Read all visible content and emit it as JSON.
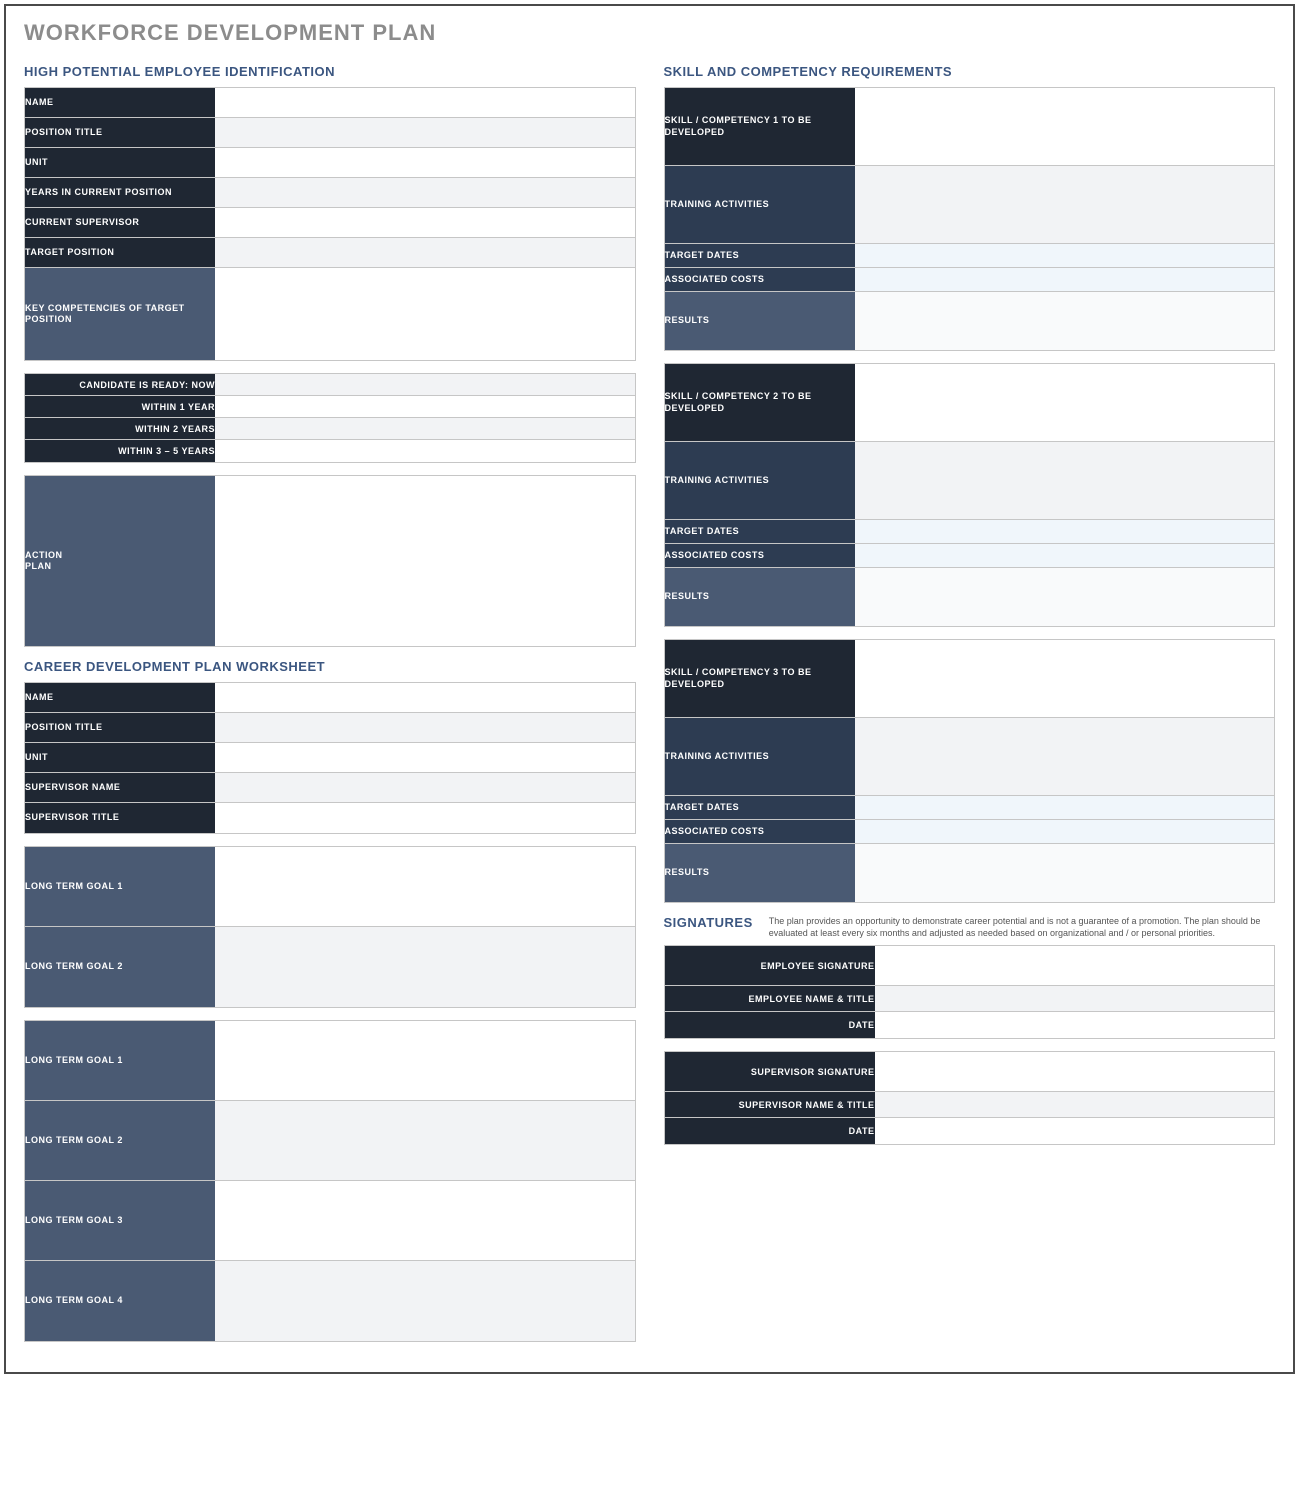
{
  "title": "WORKFORCE DEVELOPMENT PLAN",
  "left": {
    "section1_title": "HIGH POTENTIAL EMPLOYEE IDENTIFICATION",
    "name_lbl": "NAME",
    "position_lbl": "POSITION TITLE",
    "unit_lbl": "UNIT",
    "years_lbl": "YEARS IN CURRENT POSITION",
    "supervisor_lbl": "CURRENT SUPERVISOR",
    "target_pos_lbl": "TARGET POSITION",
    "key_comp_lbl": "KEY COMPETENCIES OF TARGET POSITION",
    "ready_now_lbl": "CANDIDATE IS READY:  NOW",
    "ready_1y_lbl": "WITHIN 1 YEAR",
    "ready_2y_lbl": "WITHIN 2 YEARS",
    "ready_35y_lbl": "WITHIN 3 – 5 YEARS",
    "action_plan_lbl": "ACTION\nPLAN",
    "section2_title": "CAREER DEVELOPMENT PLAN WORKSHEET",
    "c_name_lbl": "NAME",
    "c_position_lbl": "POSITION TITLE",
    "c_unit_lbl": "UNIT",
    "c_supname_lbl": "SUPERVISOR NAME",
    "c_suptitle_lbl": "SUPERVISOR TITLE",
    "ltg1a": "LONG TERM GOAL 1",
    "ltg2a": "LONG TERM GOAL 2",
    "ltg1b": "LONG TERM GOAL 1",
    "ltg2b": "LONG TERM GOAL 2",
    "ltg3b": "LONG TERM GOAL 3",
    "ltg4b": "LONG TERM GOAL 4"
  },
  "right": {
    "section_title": "SKILL AND COMPETENCY REQUIREMENTS",
    "sc1": "SKILL / COMPETENCY 1 TO BE DEVELOPED",
    "sc2": "SKILL / COMPETENCY 2 TO BE DEVELOPED",
    "sc3": "SKILL / COMPETENCY 3 TO BE DEVELOPED",
    "training_lbl": "TRAINING ACTIVITIES",
    "target_dates_lbl": "TARGET DATES",
    "costs_lbl": "ASSOCIATED COSTS",
    "results_lbl": "RESULTS",
    "sig_title": "SIGNATURES",
    "sig_desc": "The plan provides an opportunity to demonstrate career potential and is not a guarantee of a promotion. The plan should be evaluated at least every six months and adjusted as needed based on organizational and / or personal priorities.",
    "emp_sig_lbl": "EMPLOYEE SIGNATURE",
    "emp_name_lbl": "EMPLOYEE NAME & TITLE",
    "date_lbl": "DATE",
    "sup_sig_lbl": "SUPERVISOR SIGNATURE",
    "sup_name_lbl": "SUPERVISOR NAME & TITLE"
  },
  "values": {
    "hp_name": "",
    "hp_position": "",
    "hp_unit": "",
    "hp_years": "",
    "hp_supervisor": "",
    "hp_target_pos": "",
    "hp_key_comp": "",
    "ready_now": "",
    "ready_1y": "",
    "ready_2y": "",
    "ready_35y": "",
    "action_plan": "",
    "c_name": "",
    "c_position": "",
    "c_unit": "",
    "c_supname": "",
    "c_suptitle": "",
    "ltg1a": "",
    "ltg2a": "",
    "ltg1b": "",
    "ltg2b": "",
    "ltg3b": "",
    "ltg4b": "",
    "sc1_skill": "",
    "sc1_training": "",
    "sc1_dates": "",
    "sc1_costs": "",
    "sc1_results": "",
    "sc2_skill": "",
    "sc2_training": "",
    "sc2_dates": "",
    "sc2_costs": "",
    "sc2_results": "",
    "sc3_skill": "",
    "sc3_training": "",
    "sc3_dates": "",
    "sc3_costs": "",
    "sc3_results": "",
    "emp_sig": "",
    "emp_name": "",
    "emp_date": "",
    "sup_sig": "",
    "sup_name": "",
    "sup_date": ""
  }
}
